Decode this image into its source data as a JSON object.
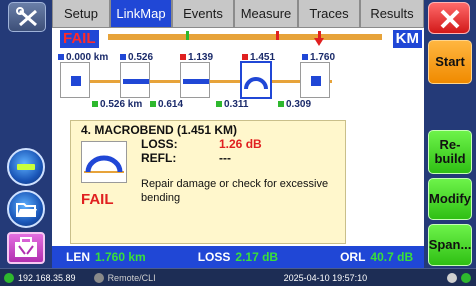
{
  "tabs": [
    {
      "label": "Setup"
    },
    {
      "label": "LinkMap",
      "active": true
    },
    {
      "label": "Events"
    },
    {
      "label": "Measure"
    },
    {
      "label": "Traces"
    },
    {
      "label": "Results"
    }
  ],
  "verdict": "FAIL",
  "unit": "KM",
  "events": [
    {
      "position": "0.000 km",
      "marker_color": "#2047d6"
    },
    {
      "position": "0.526",
      "marker_color": "#2047d6"
    },
    {
      "position": "1.139",
      "marker_color": "#e02020"
    },
    {
      "position": "1.451",
      "marker_color": "#e02020"
    },
    {
      "position": "1.760",
      "marker_color": "#2047d6"
    }
  ],
  "segments": [
    "0.526 km",
    "0.614",
    "0.311",
    "0.309"
  ],
  "detail": {
    "title": "4. MACROBEND (1.451 KM)",
    "loss_label": "LOSS:",
    "loss_value": "1.26 dB",
    "refl_label": "REFL:",
    "refl_value": "---",
    "verdict": "FAIL",
    "advice": "Repair damage or check for excessive bending"
  },
  "summary": {
    "len_label": "LEN",
    "len_value": "1.760 km",
    "loss_label": "LOSS",
    "loss_value": "2.17 dB",
    "orl_label": "ORL",
    "orl_value": "40.7 dB"
  },
  "side_buttons": {
    "start": "Start",
    "rebuild": "Re-\nbuild",
    "modify": "Modify",
    "span": "Span..."
  },
  "status": {
    "ip": "192.168.35.89",
    "remote": "Remote/CLI",
    "datetime": "2025-04-10  19:57:10"
  },
  "colors": {
    "accent_blue": "#2047d6",
    "fail_red": "#e02020",
    "ok_green": "#2eb82e",
    "fiber_orange": "#e7a33a"
  }
}
